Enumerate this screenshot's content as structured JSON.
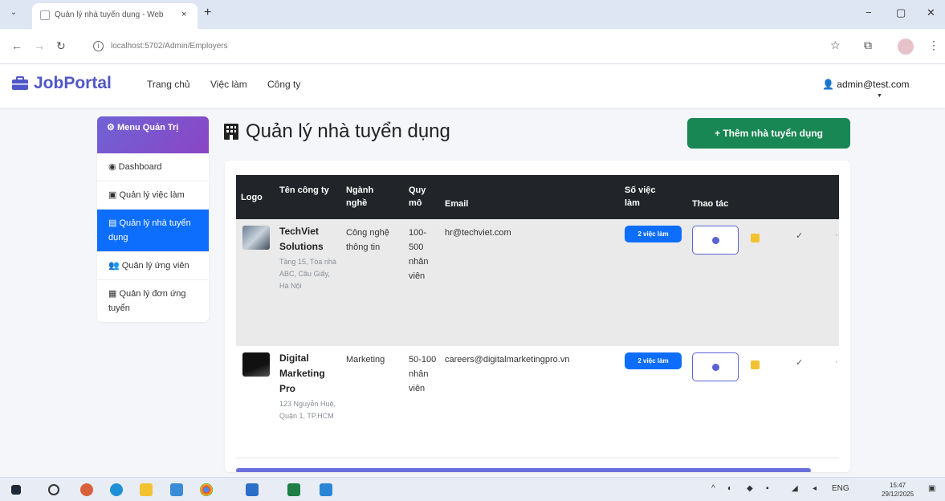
{
  "browser": {
    "tab_title": "Quản lý nhà tuyển dụng - Web",
    "tab_close": "×",
    "new_tab": "+",
    "url": "localhost:5702/Admin/Employers",
    "minimize": "−",
    "maximize": "▢",
    "close": "✕"
  },
  "navbar": {
    "brand": "JobPortal",
    "links": [
      "Trang chủ",
      "Việc làm",
      "Công ty"
    ],
    "user": "admin@test.com"
  },
  "sidebar": {
    "header": "Menu Quản Trị",
    "items": [
      "Dashboard",
      "Quản lý việc làm",
      "Quản lý nhà tuyển dụng",
      "Quản lý ứng viên",
      "Quản lý đơn ứng tuyển"
    ],
    "active_index": 2
  },
  "page": {
    "title": "Quản lý nhà tuyển dụng",
    "add_button": "+ Thêm nhà tuyển dụng"
  },
  "table": {
    "headers": [
      "Logo",
      "Tên công ty",
      "Ngành nghề",
      "Quy mô",
      "Email",
      "Số việc làm",
      "Thao tác"
    ],
    "rows": [
      {
        "name": "TechViet Solutions",
        "address": "Tầng 15, Tòa nhà ABC, Cầu Giấy, Hà Nội",
        "industry": "Công nghệ thông tin",
        "size": "100-500 nhân viên",
        "email": "hr@techviet.com",
        "jobs": "2 việc làm"
      },
      {
        "name": "Digital Marketing Pro",
        "address": "123 Nguyễn Huệ, Quận 1, TP.HCM",
        "industry": "Marketing",
        "size": "50-100 nhân viên",
        "email": "careers@digitalmarketingpro.vn",
        "jobs": "2 việc làm"
      }
    ]
  },
  "taskbar": {
    "tray_lang": "ENG",
    "time": "15:47",
    "date": "29/12/2025"
  },
  "colors": {
    "brand": "#4f57c9",
    "primary": "#0d6efd",
    "success": "#198754",
    "table_header": "#212529"
  }
}
